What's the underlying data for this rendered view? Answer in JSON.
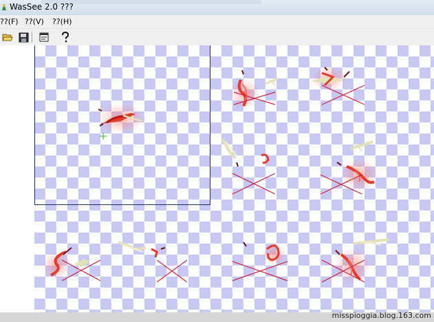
{
  "window": {
    "title": "WasSee 2.0 ???"
  },
  "menu": {
    "items": [
      {
        "label": "??(F)"
      },
      {
        "label": "??(V)"
      },
      {
        "label": "??(H)"
      }
    ]
  },
  "toolbar": {
    "icons": [
      "open-folder-icon",
      "save-disk-icon",
      "properties-icon",
      "help-question-icon"
    ]
  },
  "canvas": {
    "background": "checkerboard",
    "checker_colors": [
      "#ffffff",
      "#c8c8f5"
    ],
    "frame_count": 8
  },
  "watermark": {
    "text": "misspioggia.blog.163.com"
  },
  "colors": {
    "cross": "#d02040",
    "effect": "#e33a2a",
    "preview_border": "#1c2a6e"
  }
}
